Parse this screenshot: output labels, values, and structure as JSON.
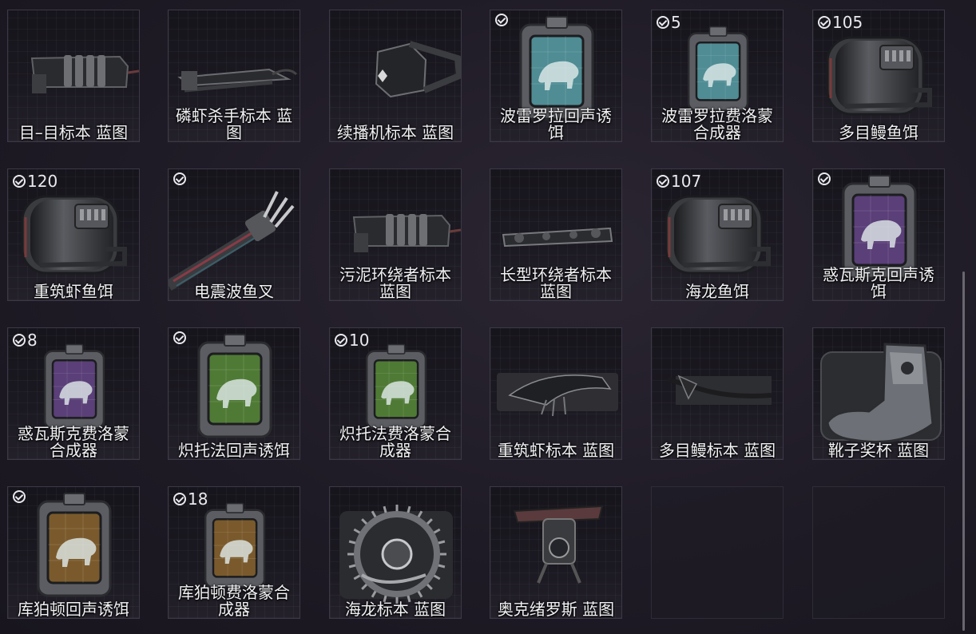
{
  "items": [
    {
      "label": "目–目标本 蓝图",
      "art": "blueprint-gun",
      "owned": false,
      "count": ""
    },
    {
      "label": "磷虾杀手标本 蓝图",
      "art": "blueprint-rail",
      "owned": false,
      "count": ""
    },
    {
      "label": "续播机标本 蓝图",
      "art": "blueprint-cube",
      "owned": false,
      "count": ""
    },
    {
      "label": "波雷罗拉回声诱饵",
      "art": "lure-teal",
      "owned": true,
      "count": ""
    },
    {
      "label": "波雷罗拉费洛蒙合成器",
      "art": "synth-teal",
      "owned": true,
      "count": "5"
    },
    {
      "label": "多目鳗鱼饵",
      "art": "canister",
      "owned": true,
      "count": "105"
    },
    {
      "label": "重筑虾鱼饵",
      "art": "canister",
      "owned": true,
      "count": "120"
    },
    {
      "label": "电震波鱼叉",
      "art": "harpoon",
      "owned": true,
      "count": ""
    },
    {
      "label": "污泥环绕者标本 蓝图",
      "art": "blueprint-gun",
      "owned": false,
      "count": ""
    },
    {
      "label": "长型环绕者标本 蓝图",
      "art": "blueprint-long",
      "owned": false,
      "count": ""
    },
    {
      "label": "海龙鱼饵",
      "art": "canister",
      "owned": true,
      "count": "107"
    },
    {
      "label": "惑瓦斯克回声诱饵",
      "art": "lure-purple",
      "owned": true,
      "count": ""
    },
    {
      "label": "惑瓦斯克费洛蒙合成器",
      "art": "synth-purple",
      "owned": true,
      "count": "8"
    },
    {
      "label": "炽托法回声诱饵",
      "art": "lure-green",
      "owned": true,
      "count": ""
    },
    {
      "label": "炽托法费洛蒙合成器",
      "art": "synth-green",
      "owned": true,
      "count": "10"
    },
    {
      "label": "重筑虾标本 蓝图",
      "art": "blueprint-shrimp",
      "owned": false,
      "count": ""
    },
    {
      "label": "多目鳗标本 蓝图",
      "art": "blueprint-eel",
      "owned": false,
      "count": ""
    },
    {
      "label": "靴子奖杯 蓝图",
      "art": "boot",
      "owned": false,
      "count": ""
    },
    {
      "label": "库狛顿回声诱饵",
      "art": "lure-amber",
      "owned": true,
      "count": ""
    },
    {
      "label": "库狛顿费洛蒙合成器",
      "art": "synth-amber",
      "owned": true,
      "count": "18"
    },
    {
      "label": "海龙标本 蓝图",
      "art": "saw",
      "owned": false,
      "count": ""
    },
    {
      "label": "奥克绪罗斯 蓝图",
      "art": "drone",
      "owned": false,
      "count": ""
    },
    {
      "label": "",
      "art": "",
      "owned": false,
      "count": "",
      "empty": true
    },
    {
      "label": "",
      "art": "",
      "owned": false,
      "count": "",
      "empty": true
    }
  ],
  "colors": {
    "teal": "#4f8c94",
    "purple": "#5a3f78",
    "green": "#4f7a35",
    "amber": "#7a5a2c"
  }
}
